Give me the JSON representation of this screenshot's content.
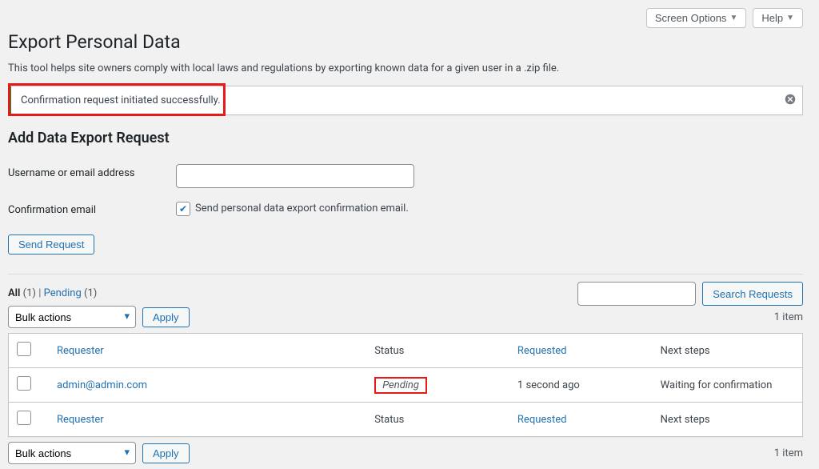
{
  "top": {
    "screen_options": "Screen Options",
    "help": "Help"
  },
  "page": {
    "title": "Export Personal Data",
    "description": "This tool helps site owners comply with local laws and regulations by exporting known data for a given user in a .zip file."
  },
  "notice": {
    "message": "Confirmation request initiated successfully."
  },
  "form": {
    "heading": "Add Data Export Request",
    "username_label": "Username or email address",
    "username_value": "",
    "confirmation_label": "Confirmation email",
    "checkbox_label": "Send personal data export confirmation email.",
    "submit_label": "Send Request"
  },
  "filters": {
    "all_label": "All",
    "all_count": "(1)",
    "pending_label": "Pending",
    "pending_count": "(1)",
    "separator": " | "
  },
  "search": {
    "value": "",
    "button": "Search Requests"
  },
  "bulk": {
    "placeholder": "Bulk actions",
    "apply": "Apply"
  },
  "table": {
    "item_count_label": "1 item",
    "headers": {
      "requester": "Requester",
      "status": "Status",
      "requested": "Requested",
      "next_steps": "Next steps"
    },
    "rows": [
      {
        "requester": "admin@admin.com",
        "status": "Pending",
        "requested": "1 second ago",
        "next_steps": "Waiting for confirmation"
      }
    ]
  }
}
